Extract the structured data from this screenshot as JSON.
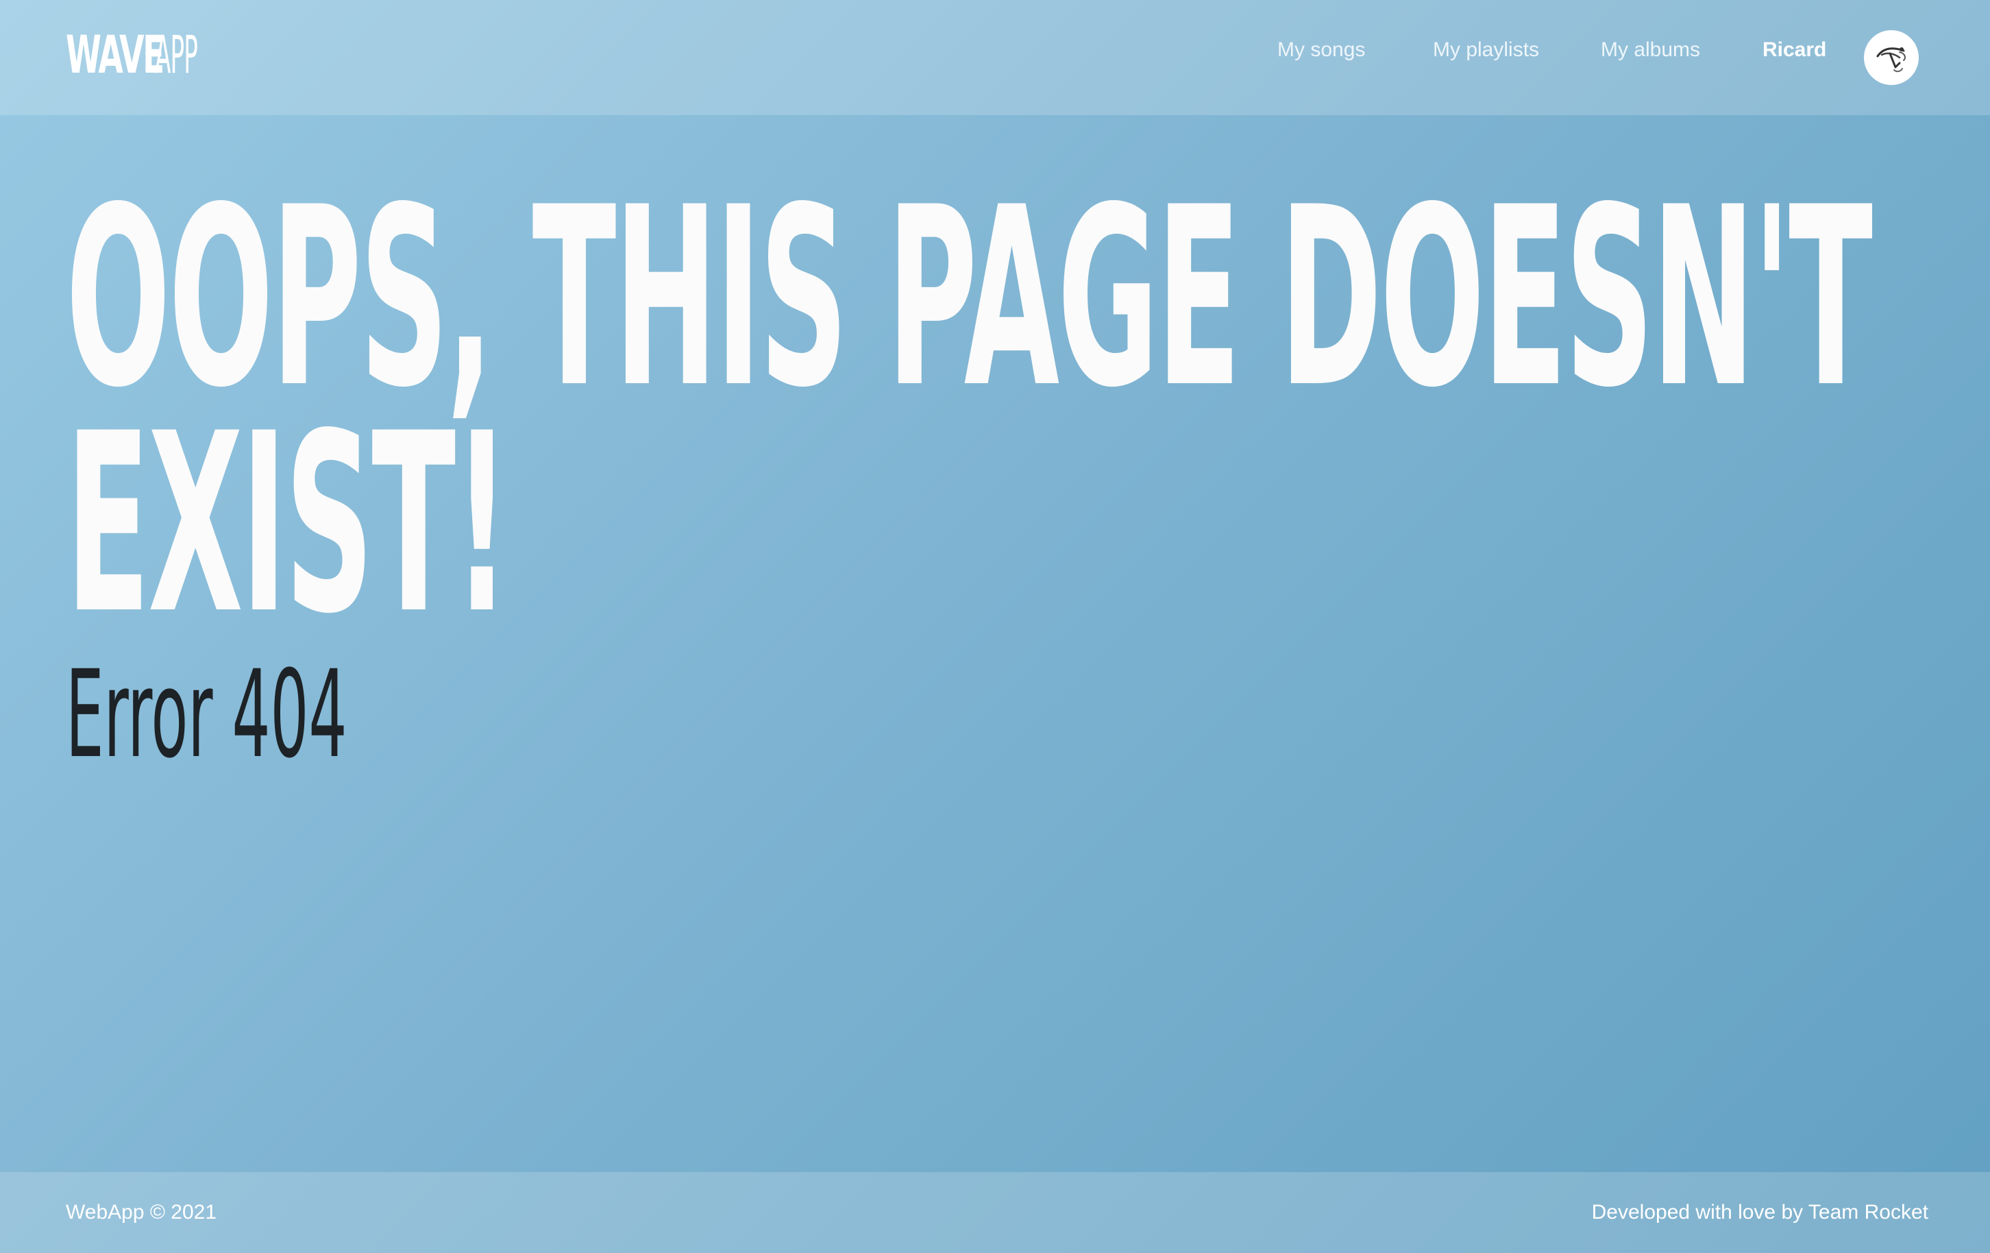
{
  "header": {
    "logo_bold": "WAVE",
    "logo_light": "APP",
    "nav": {
      "songs": "My songs",
      "playlists": "My playlists",
      "albums": "My albums"
    },
    "user_name": "Ricard",
    "avatar_icon": "avatar-hand-drawn-icon"
  },
  "main": {
    "headline_line1": "OOPS, THIS PAGE DOESN'T",
    "headline_line2": "EXIST!",
    "error_code": "Error 404"
  },
  "footer": {
    "copyright": "WebApp © 2021",
    "credits": "Developed with love by Team Rocket"
  },
  "colors": {
    "background_start": "#98c9e3",
    "background_end": "#62a0c2",
    "headline": "#fbfbfb",
    "error_text": "#1d2226"
  }
}
